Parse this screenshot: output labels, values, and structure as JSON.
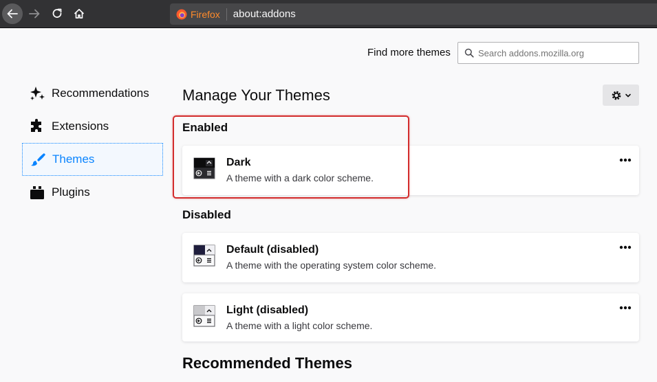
{
  "browser": {
    "brand_label": "Firefox",
    "url": "about:addons"
  },
  "header": {
    "find_more_label": "Find more themes",
    "search_placeholder": "Search addons.mozilla.org"
  },
  "sidebar": {
    "items": [
      {
        "label": "Recommendations",
        "icon": "sparkle-icon"
      },
      {
        "label": "Extensions",
        "icon": "puzzle-icon"
      },
      {
        "label": "Themes",
        "icon": "brush-icon",
        "selected": true
      },
      {
        "label": "Plugins",
        "icon": "plugin-icon"
      }
    ]
  },
  "main": {
    "title": "Manage Your Themes",
    "enabled_heading": "Enabled",
    "disabled_heading": "Disabled",
    "recommended_heading": "Recommended Themes",
    "themes": {
      "dark": {
        "name": "Dark",
        "description": "A theme with a dark color scheme."
      },
      "default": {
        "name": "Default (disabled)",
        "description": "A theme with the operating system color scheme."
      },
      "light": {
        "name": "Light (disabled)",
        "description": "A theme with a light color scheme."
      }
    }
  },
  "colors": {
    "accent": "#0a84ff",
    "highlight": "#d32c2c",
    "toolbar": "#323234",
    "firefox_orange": "#ff8b2b"
  }
}
